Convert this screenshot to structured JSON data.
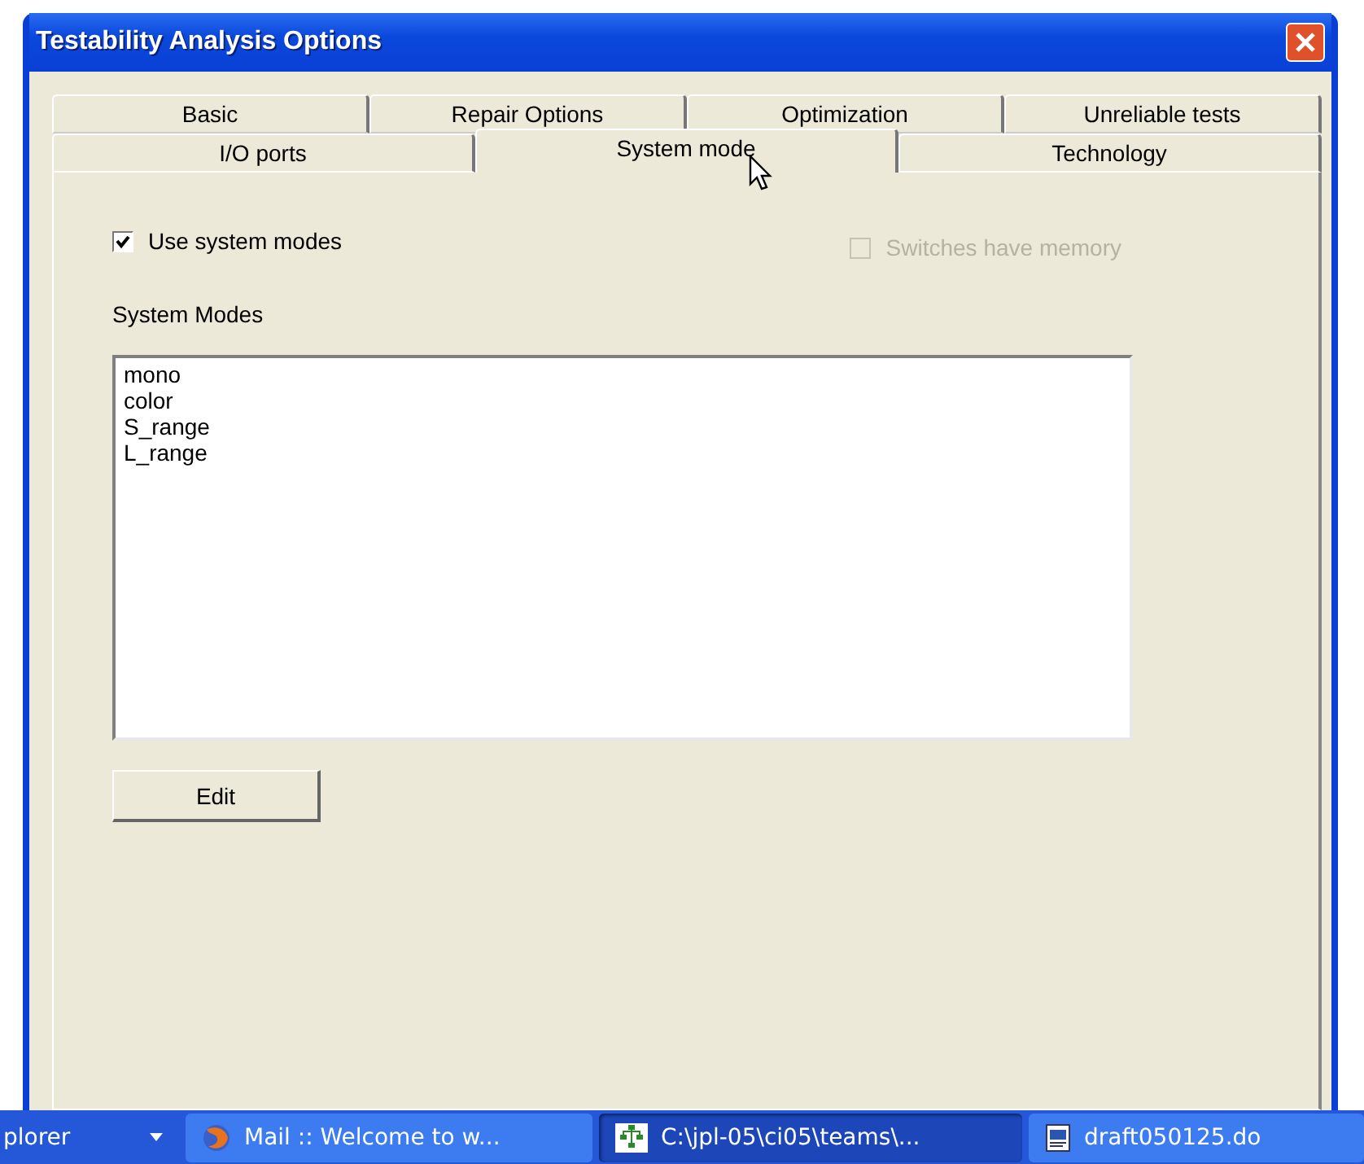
{
  "window": {
    "title": "Testability Analysis Options"
  },
  "tab_rows": [
    [
      {
        "label": "Basic",
        "selected": false
      },
      {
        "label": "Repair Options",
        "selected": false
      },
      {
        "label": "Optimization",
        "selected": false
      },
      {
        "label": "Unreliable tests",
        "selected": false
      }
    ],
    [
      {
        "label": "I/O ports",
        "selected": false
      },
      {
        "label": "System mode",
        "selected": true
      },
      {
        "label": "Technology",
        "selected": false
      }
    ]
  ],
  "options": [
    {
      "label": "Use system modes",
      "checked": true,
      "disabled": false
    },
    {
      "label": "Switches have memory",
      "checked": false,
      "disabled": true
    }
  ],
  "system_modes": {
    "label": "System Modes",
    "items": [
      "mono",
      "color",
      "S_range",
      "L_range"
    ]
  },
  "buttons": [
    "Edit"
  ],
  "taskbar": [
    {
      "label": "plorer",
      "kind": "menu",
      "selected": false
    },
    {
      "label": "Mail :: Welcome to w...",
      "kind": "browser",
      "selected": false
    },
    {
      "label": "C:\\jpl-05\\ci05\\teams\\...",
      "kind": "tree",
      "selected": true
    },
    {
      "label": "draft050125.do",
      "kind": "document",
      "selected": false
    }
  ]
}
